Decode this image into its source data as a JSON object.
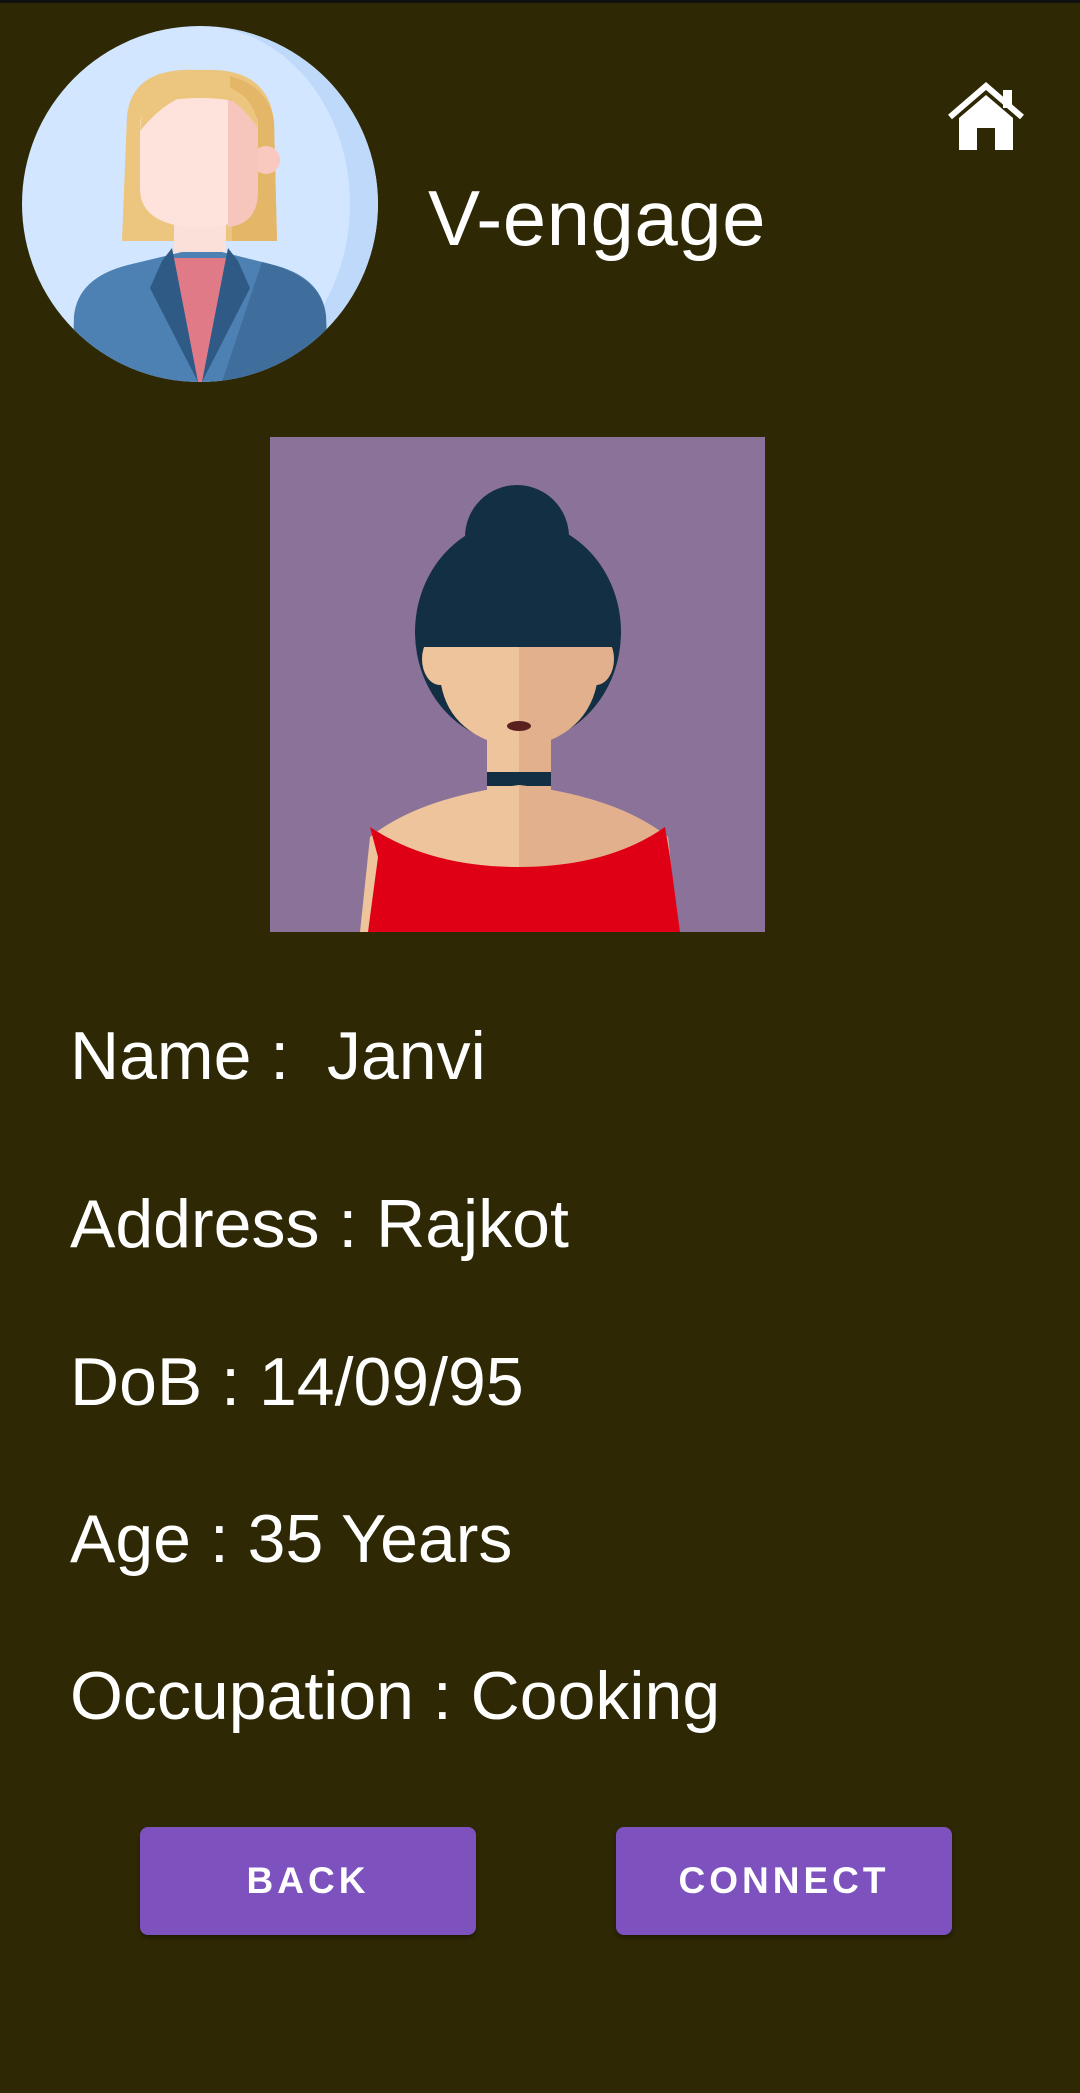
{
  "app": {
    "title": "V-engage"
  },
  "icons": {
    "header_avatar": "businesswoman-avatar-icon",
    "home": "home-icon",
    "profile_photo": "woman-bun-hair-avatar"
  },
  "profile": {
    "name_line": "Name :  Janvi",
    "address_line": "Address : Rajkot",
    "dob_line": "DoB : 14/09/95",
    "age_line": "Age : 35 Years",
    "occupation_line": "Occupation : Cooking"
  },
  "buttons": {
    "back_label": "BACK",
    "connect_label": "CONNECT"
  },
  "colors": {
    "background": "#2e2904",
    "button": "#7e52be",
    "text": "#ffffff",
    "photo_background": "#8b7299"
  }
}
